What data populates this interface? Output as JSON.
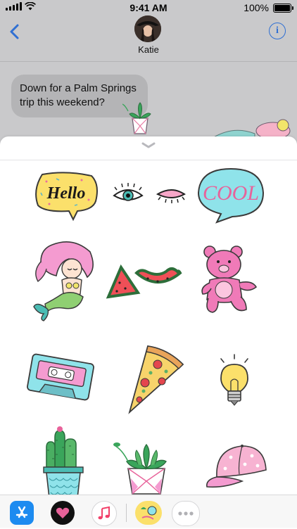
{
  "status_bar": {
    "time": "9:41 AM",
    "battery": "100%"
  },
  "nav": {
    "contact_name": "Katie",
    "info_glyph": "i"
  },
  "messages": [
    {
      "text": "Down for a Palm Springs trip this weekend?"
    }
  ],
  "drawer": {
    "stickers": [
      {
        "name": "hello-speech-bubble",
        "text": "Hello"
      },
      {
        "name": "eyes",
        "text": ""
      },
      {
        "name": "cool-speech-bubble",
        "text": "COOL"
      },
      {
        "name": "mermaid",
        "text": ""
      },
      {
        "name": "watermelon",
        "text": ""
      },
      {
        "name": "pink-teddy-bear",
        "text": ""
      },
      {
        "name": "cassette-tape",
        "text": ""
      },
      {
        "name": "pizza-slice",
        "text": ""
      },
      {
        "name": "light-bulb",
        "text": ""
      },
      {
        "name": "cactus-pot",
        "text": ""
      },
      {
        "name": "succulent-pot",
        "text": ""
      },
      {
        "name": "baseball-cap",
        "text": ""
      }
    ]
  },
  "tray": {
    "apps": [
      {
        "name": "app-store-icon"
      },
      {
        "name": "digital-touch-icon"
      },
      {
        "name": "music-icon"
      },
      {
        "name": "sticker-pack-icon"
      },
      {
        "name": "more-icon"
      }
    ]
  }
}
